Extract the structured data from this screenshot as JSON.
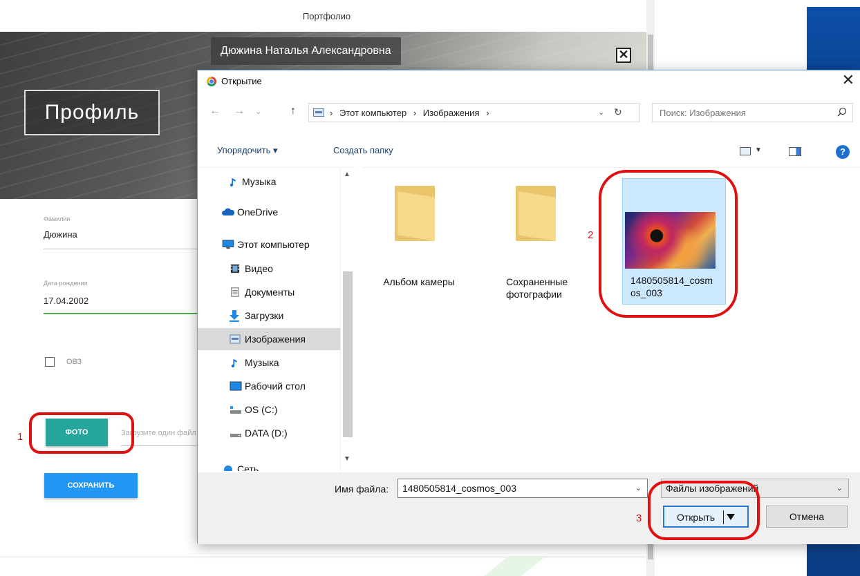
{
  "page": {
    "nav_title": "Портфолио",
    "hero_name": "Дюжина Наталья Александровна",
    "hero_close": "✕",
    "profile_title": "Профиль",
    "surname_label": "Фамилия",
    "surname_value": "Дюжина",
    "birth_label": "Дата рождения",
    "birth_value": "17.04.2002",
    "ovz_label": "ОВЗ",
    "photo_button": "ФОТО",
    "upload_placeholder": "Загрузите один файл",
    "save_button": "СОХРАНИТЬ"
  },
  "dialog": {
    "title": "Открытие",
    "close": "✕",
    "nav": {
      "back": "←",
      "forward": "→",
      "recent": "⌄",
      "up": "↑"
    },
    "address": [
      "Этот компьютер",
      "Изображения"
    ],
    "address_sep": "›",
    "address_drop": "⌄",
    "refresh": "↻",
    "search_placeholder": "Поиск: Изображения",
    "toolbar": {
      "organize": "Упорядочить ▾",
      "new_folder": "Создать папку",
      "help": "?"
    },
    "sidebar": {
      "items": [
        {
          "label": "Музыка",
          "icon": "music-icon"
        },
        {
          "label": "OneDrive",
          "icon": "cloud-icon"
        },
        {
          "label": "Этот компьютер",
          "icon": "computer-icon"
        },
        {
          "label": "Видео",
          "icon": "video-icon"
        },
        {
          "label": "Документы",
          "icon": "document-icon"
        },
        {
          "label": "Загрузки",
          "icon": "download-icon"
        },
        {
          "label": "Изображения",
          "icon": "pictures-icon",
          "selected": true
        },
        {
          "label": "Музыка",
          "icon": "music-icon"
        },
        {
          "label": "Рабочий стол",
          "icon": "desktop-icon"
        },
        {
          "label": "OS (C:)",
          "icon": "drive-icon"
        },
        {
          "label": "DATA (D:)",
          "icon": "drive-icon"
        },
        {
          "label": "Сеть",
          "icon": "network-icon"
        }
      ]
    },
    "files": [
      {
        "label": "Альбом камеры",
        "type": "folder"
      },
      {
        "label": "Сохраненные фотографии",
        "type": "folder"
      },
      {
        "label": "1480505814_cosmos_003",
        "type": "image",
        "selected": true
      }
    ],
    "filename_label": "Имя файла:",
    "filename_value": "1480505814_cosmos_003",
    "filter_value": "Файлы изображений",
    "open_button": "Открыть",
    "cancel_button": "Отмена"
  },
  "annotations": {
    "step1": "1",
    "step2": "2",
    "step3": "3"
  },
  "colors": {
    "accent_green": "#26a69a",
    "accent_blue": "#2196f3",
    "annotation_red": "#e01010",
    "selection": "#cce8ff"
  }
}
